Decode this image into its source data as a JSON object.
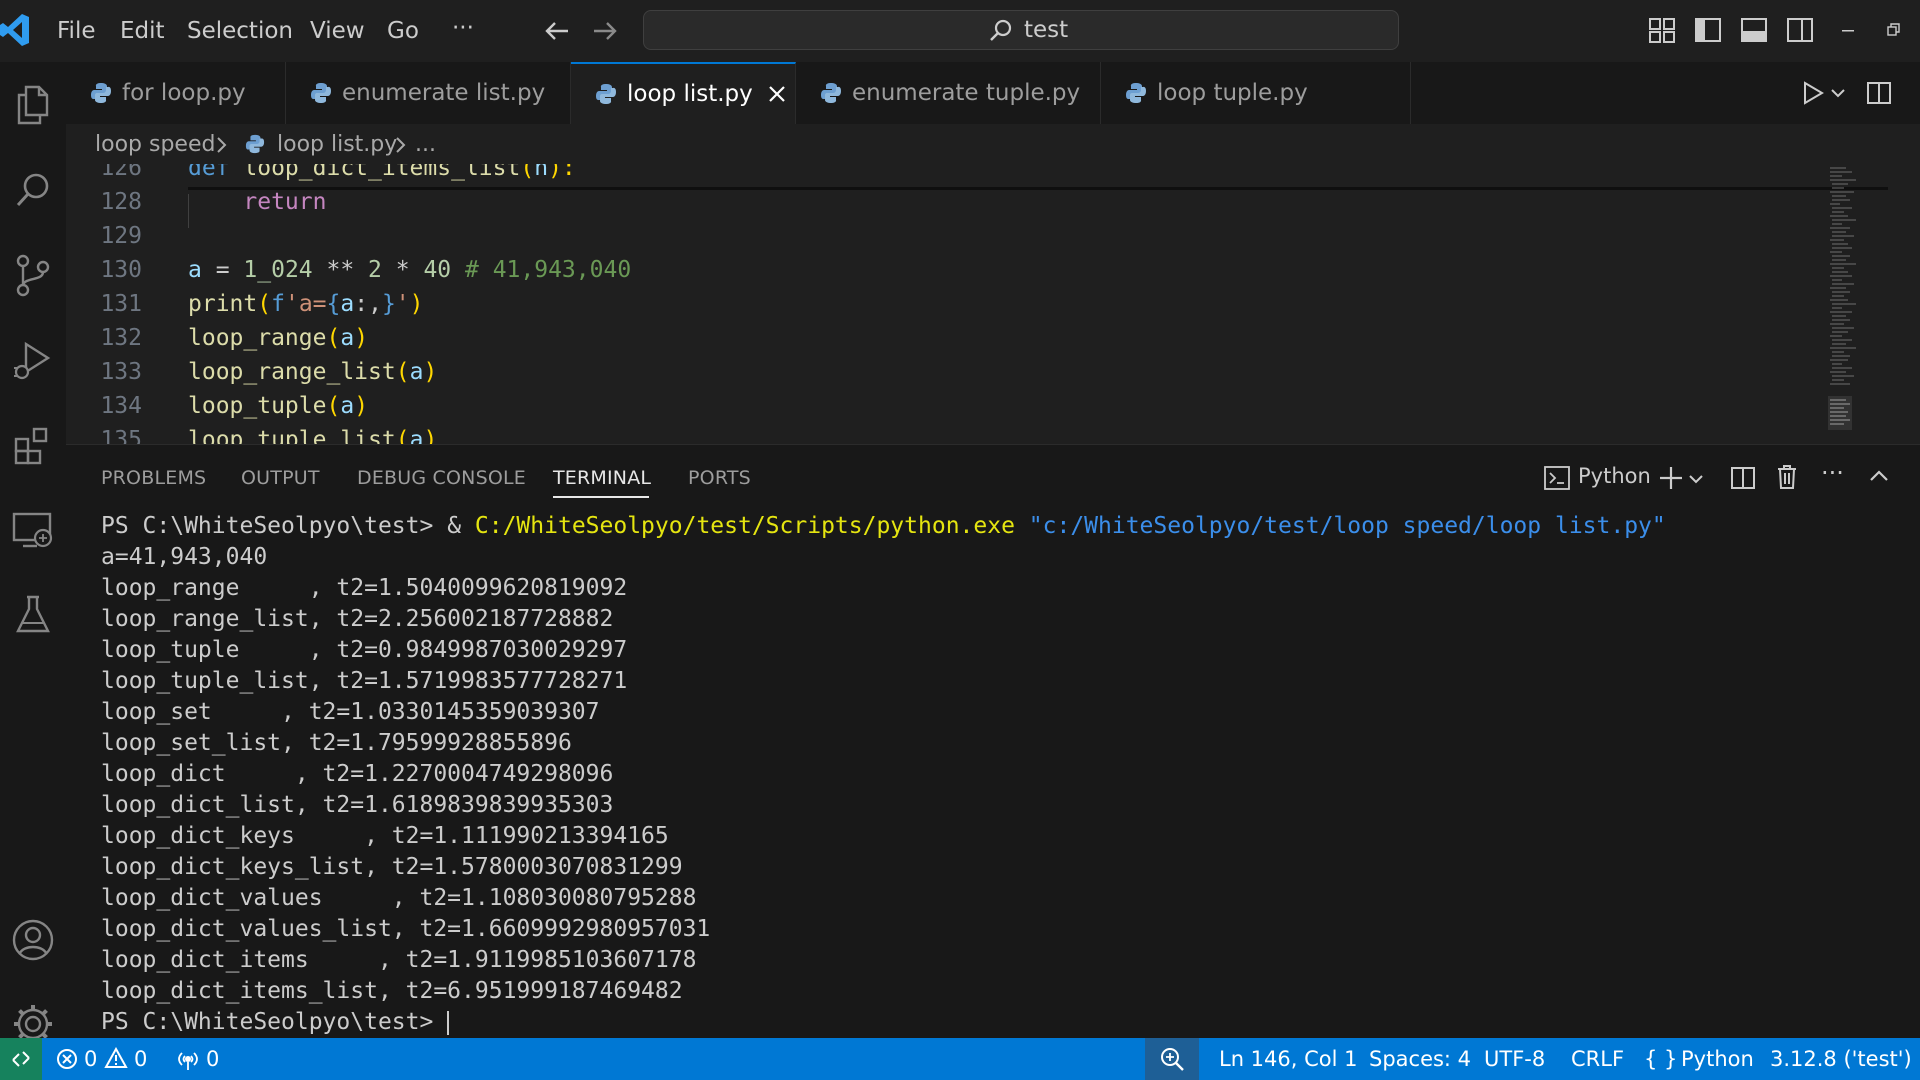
{
  "title_bar": {
    "menu": [
      "File",
      "Edit",
      "Selection",
      "View",
      "Go"
    ],
    "more": "···",
    "search": {
      "text": "test"
    }
  },
  "tabs": [
    {
      "label": "for loop.py",
      "active": false
    },
    {
      "label": "enumerate list.py",
      "active": false
    },
    {
      "label": "loop list.py",
      "active": true
    },
    {
      "label": "enumerate tuple.py",
      "active": false
    },
    {
      "label": "loop tuple.py",
      "active": false
    }
  ],
  "breadcrumb": {
    "folder": "loop speed",
    "file": "loop list.py",
    "more": "..."
  },
  "editor": {
    "lines": [
      {
        "num": "126",
        "parts": [
          [
            "kw2",
            "def "
          ],
          [
            "fn",
            "loop_dict_items_list"
          ],
          [
            "paren",
            "("
          ],
          [
            "var",
            "n"
          ],
          [
            "paren",
            "):"
          ]
        ]
      },
      {
        "num": "128",
        "parts": [
          [
            "",
            "    "
          ],
          [
            "kw",
            "return"
          ]
        ]
      },
      {
        "num": "129",
        "parts": []
      },
      {
        "num": "130",
        "parts": [
          [
            "var",
            "a"
          ],
          [
            "",
            " = "
          ],
          [
            "num",
            "1_024"
          ],
          [
            "",
            " ** "
          ],
          [
            "num",
            "2"
          ],
          [
            "",
            " * "
          ],
          [
            "num",
            "40"
          ],
          [
            "cmt",
            " # 41,943,040"
          ]
        ]
      },
      {
        "num": "131",
        "parts": [
          [
            "fn",
            "print"
          ],
          [
            "paren",
            "("
          ],
          [
            "kw2",
            "f"
          ],
          [
            "str",
            "'a="
          ],
          [
            "brace",
            "{"
          ],
          [
            "var",
            "a"
          ],
          [
            "",
            ":,"
          ],
          [
            "brace",
            "}"
          ],
          [
            "str",
            "'"
          ],
          [
            "paren",
            ")"
          ]
        ]
      },
      {
        "num": "132",
        "parts": [
          [
            "fn",
            "loop_range"
          ],
          [
            "paren",
            "("
          ],
          [
            "var",
            "a"
          ],
          [
            "paren",
            ")"
          ]
        ]
      },
      {
        "num": "133",
        "parts": [
          [
            "fn",
            "loop_range_list"
          ],
          [
            "paren",
            "("
          ],
          [
            "var",
            "a"
          ],
          [
            "paren",
            ")"
          ]
        ]
      },
      {
        "num": "134",
        "parts": [
          [
            "fn",
            "loop_tuple"
          ],
          [
            "paren",
            "("
          ],
          [
            "var",
            "a"
          ],
          [
            "paren",
            ")"
          ]
        ]
      },
      {
        "num": "135",
        "parts": [
          [
            "fn",
            "loop_tuple_list"
          ],
          [
            "paren",
            "("
          ],
          [
            "var",
            "a"
          ],
          [
            "paren",
            ")"
          ]
        ]
      }
    ]
  },
  "panel": {
    "tabs": [
      "PROBLEMS",
      "OUTPUT",
      "DEBUG CONSOLE",
      "TERMINAL",
      "PORTS"
    ],
    "active_tab": "TERMINAL",
    "shell_label": "Python"
  },
  "terminal": {
    "command": {
      "prompt": "PS C:\\WhiteSeolpyo\\test> ",
      "amp": "& ",
      "exe": "C:/WhiteSeolpyo/test/Scripts/python.exe",
      "arg": " \"c:/WhiteSeolpyo/test/loop speed/loop list.py\""
    },
    "output": [
      "a=41,943,040",
      "loop_range     , t2=1.5040099620819092",
      "loop_range_list, t2=2.256002187728882",
      "loop_tuple     , t2=0.9849987030029297",
      "loop_tuple_list, t2=1.5719983577728271",
      "loop_set     , t2=1.0330145359039307",
      "loop_set_list, t2=1.79599928855896",
      "loop_dict     , t2=1.2270004749298096",
      "loop_dict_list, t2=1.6189839839935303",
      "loop_dict_keys     , t2=1.111990213394165",
      "loop_dict_keys_list, t2=1.5780003070831299",
      "loop_dict_values     , t2=1.108030080795288",
      "loop_dict_values_list, t2=1.6609992980957031",
      "loop_dict_items     , t2=1.9119985103607178",
      "loop_dict_items_list, t2=6.951999187469482"
    ],
    "final_prompt": "PS C:\\WhiteSeolpyo\\test> "
  },
  "status_bar": {
    "errors": "0",
    "warnings": "0",
    "ports": "0",
    "position": "Ln 146, Col 1",
    "spaces": "Spaces: 4",
    "encoding": "UTF-8",
    "eol": "CRLF",
    "language": "Python",
    "interpreter": "3.12.8 ('test')"
  },
  "colors": {
    "accent": "#0078d4",
    "remote": "#16825d",
    "background": "#1f1f1f"
  }
}
